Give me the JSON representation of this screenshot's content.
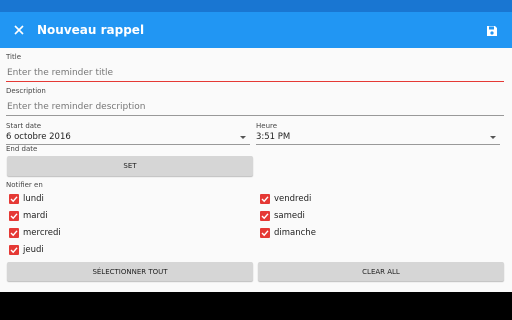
{
  "appbar": {
    "title": "Nouveau rappel",
    "close_icon": "close-icon",
    "save_icon": "save-icon"
  },
  "form": {
    "title_label": "Title",
    "title_placeholder": "Enter the reminder title",
    "description_label": "Description",
    "description_placeholder": "Enter the reminder description",
    "start_date_label": "Start date",
    "start_date_value": "6 octobre 2016",
    "hour_label": "Heure",
    "hour_value": "3:51 PM",
    "end_date_label": "End date",
    "set_button": "SET",
    "notify_label": "Notifier en",
    "days_left": [
      "lundi",
      "mardi",
      "mercredi",
      "jeudi"
    ],
    "days_right": [
      "vendredi",
      "samedi",
      "dimanche"
    ],
    "select_all_button": "SÉLECTIONNER TOUT",
    "clear_all_button": "CLEAR ALL"
  },
  "colors": {
    "primary": "#2196f3",
    "primary_dark": "#1976d2",
    "accent": "#e53935"
  }
}
